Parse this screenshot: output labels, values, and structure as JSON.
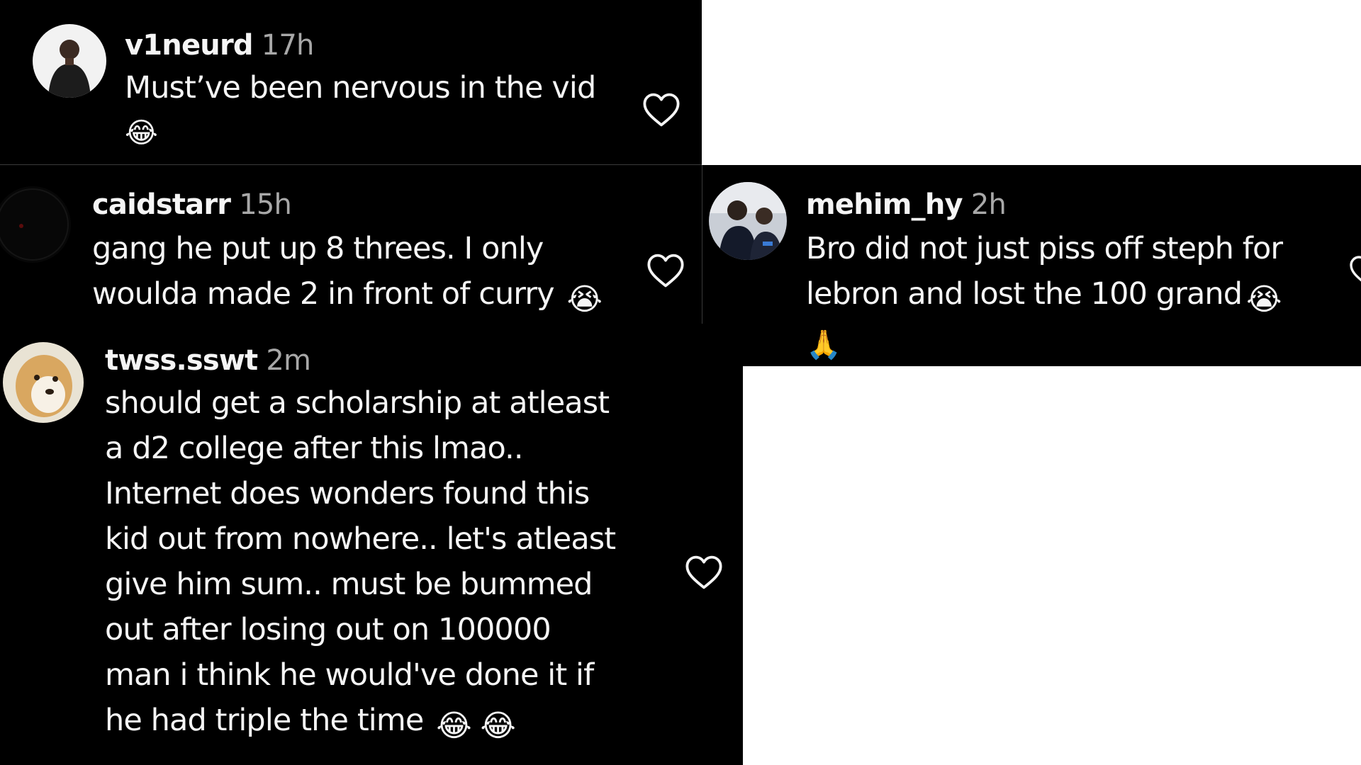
{
  "comments": [
    {
      "username": "v1neurd",
      "time": "17h",
      "lines": [
        "Must’ve been nervous in the vid"
      ],
      "emoji_line": "😂"
    },
    {
      "username": "caidstarr",
      "time": "15h",
      "lines": [
        "gang he put up 8 threes. I only",
        "woulda made 2 in front of curry"
      ],
      "emoji": "😭"
    },
    {
      "username": "mehim_hy",
      "time": "2h",
      "lines": [
        "Bro did not just piss off steph for",
        "lebron and lost the 100 grand"
      ],
      "emoji": "😭",
      "emoji_line": "🙏"
    },
    {
      "username": "twss.sswt",
      "time": "2m",
      "lines": [
        "should get a scholarship at atleast",
        "a d2 college after this lmao..",
        "Internet does wonders found this",
        "kid out from nowhere.. let's atleast",
        "give him sum.. must be bummed",
        "out after losing out on 100000",
        "man i think he would've done it if",
        "he had triple the time"
      ],
      "emoji": "😂 😂"
    }
  ],
  "icons": {
    "like": "heart-outline-icon"
  },
  "colors": {
    "background": "#000000",
    "text": "#f5f5f5",
    "timestamp": "#a8a8a8",
    "page": "#ffffff"
  }
}
